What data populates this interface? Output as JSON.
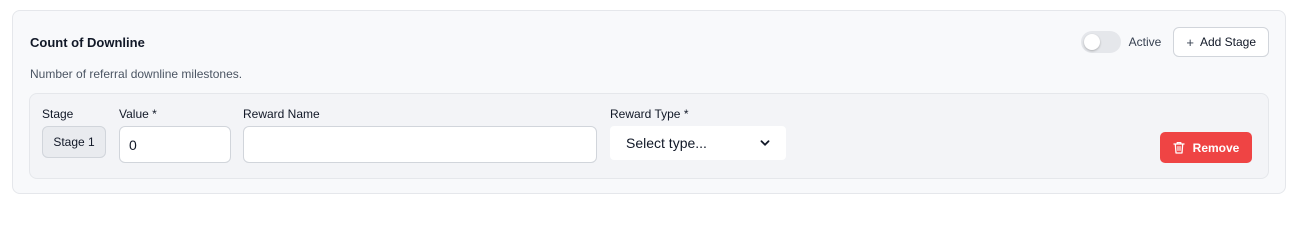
{
  "section": {
    "title": "Count of Downline",
    "description": "Number of referral downline milestones.",
    "active_label": "Active",
    "active": false,
    "add_stage_label": "Add Stage"
  },
  "stage": {
    "stage_label": "Stage",
    "stage_name": "Stage 1",
    "value_label": "Value *",
    "value": "0",
    "reward_name_label": "Reward Name",
    "reward_name_value": "",
    "reward_type_label": "Reward Type *",
    "reward_type_selected": "Select type...",
    "remove_label": "Remove"
  },
  "colors": {
    "danger": "#ef4444",
    "card_bg": "#f8f9fb",
    "border": "#e5e7eb"
  },
  "icons": {
    "add": "plus-icon",
    "remove": "trash-icon",
    "select": "chevron-down-icon"
  }
}
